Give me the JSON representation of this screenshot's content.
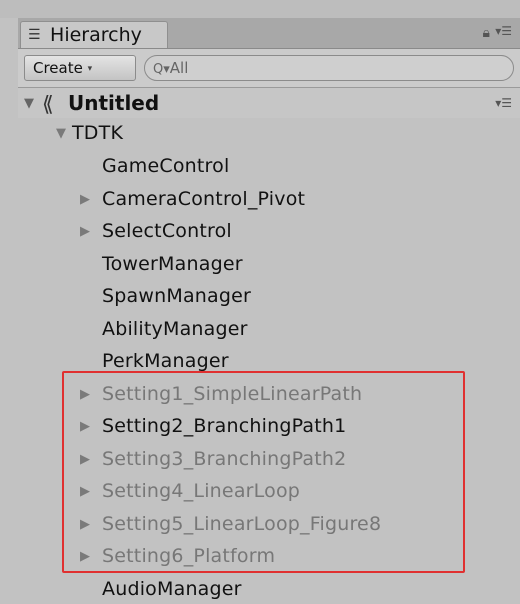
{
  "panel": {
    "tab_label": "Hierarchy",
    "tab_icon": "list-icon",
    "lock_icon": "lock-icon",
    "menu_icon": "kebab-menu-icon"
  },
  "toolbar": {
    "create_label": "Create",
    "create_arrow": "▾",
    "search_icon_glyph": "Q▾",
    "search_placeholder": "All"
  },
  "scene": {
    "expand_glyph": "▼",
    "icon_name": "unity-scene-icon",
    "title": "Untitled"
  },
  "tree": {
    "root": {
      "label": "TDTK",
      "expanded": true
    },
    "items": [
      {
        "label": "GameControl",
        "has_children": false,
        "dim": false
      },
      {
        "label": "CameraControl_Pivot",
        "has_children": true,
        "dim": false
      },
      {
        "label": "SelectControl",
        "has_children": true,
        "dim": false
      },
      {
        "label": "TowerManager",
        "has_children": false,
        "dim": false
      },
      {
        "label": "SpawnManager",
        "has_children": false,
        "dim": false
      },
      {
        "label": "AbilityManager",
        "has_children": false,
        "dim": false
      },
      {
        "label": "PerkManager",
        "has_children": false,
        "dim": false
      },
      {
        "label": "Setting1_SimpleLinearPath",
        "has_children": true,
        "dim": true
      },
      {
        "label": "Setting2_BranchingPath1",
        "has_children": true,
        "dim": false
      },
      {
        "label": "Setting3_BranchingPath2",
        "has_children": true,
        "dim": true
      },
      {
        "label": "Setting4_LinearLoop",
        "has_children": true,
        "dim": true
      },
      {
        "label": "Setting5_LinearLoop_Figure8",
        "has_children": true,
        "dim": true
      },
      {
        "label": "Setting6_Platform",
        "has_children": true,
        "dim": true
      },
      {
        "label": "AudioManager",
        "has_children": false,
        "dim": false
      }
    ]
  },
  "annotation": {
    "color": "#e03030"
  }
}
